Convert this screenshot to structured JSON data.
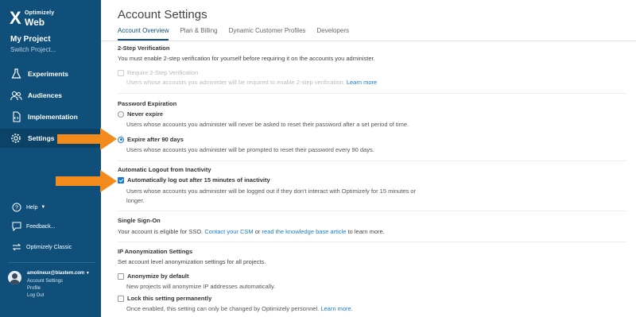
{
  "sidebar": {
    "logo_brand": "Optimizely",
    "logo_product": "Web",
    "project_name": "My Project",
    "switch_label": "Switch Project...",
    "nav": [
      {
        "label": "Experiments",
        "icon": "flask-icon"
      },
      {
        "label": "Audiences",
        "icon": "users-icon"
      },
      {
        "label": "Implementation",
        "icon": "code-icon"
      },
      {
        "label": "Settings",
        "icon": "gear-icon"
      }
    ],
    "help_label": "Help",
    "feedback_label": "Feedback...",
    "classic_label": "Optimizely Classic",
    "user": {
      "email": "amolineux@blastem.com",
      "account_settings": "Account Settings",
      "profile": "Profile",
      "logout": "Log Out"
    }
  },
  "main": {
    "title": "Account Settings",
    "tabs": [
      {
        "label": "Account Overview",
        "active": true
      },
      {
        "label": "Plan & Billing"
      },
      {
        "label": "Dynamic Customer Profiles"
      },
      {
        "label": "Developers"
      }
    ],
    "two_step": {
      "heading": "2-Step Verification",
      "text": "You must enable 2-step verification for yourself before requiring it on the accounts you administer.",
      "option": "Require 2-Step Verification",
      "option_desc": "Users whose accounts you administer will be required to enable 2-step verification.",
      "learn_more": "Learn more"
    },
    "password_expiration": {
      "heading": "Password Expiration",
      "never_label": "Never expire",
      "never_desc": "Users whose accounts you administer will never be asked to reset their password after a set period of time.",
      "expire_label": "Expire after 90 days",
      "expire_desc": "Users whose accounts you administer will be prompted to reset their password every 90 days."
    },
    "auto_logout": {
      "heading": "Automatic Logout from Inactivity",
      "option": "Automatically log out after 15 minutes of inactivity",
      "desc_line1": "Users whose accounts you administer will be logged out if they don't interact with Optimizely for 15 minutes or",
      "desc_line2": "longer."
    },
    "sso": {
      "heading": "Single Sign-On",
      "text_prefix": "Your account is eligible for SSO.",
      "contact": "Contact your CSM",
      "or": "or",
      "kb_link": "read the knowledge base article",
      "text_suffix": "to learn more."
    },
    "ip_anon": {
      "heading": "IP Anonymization Settings",
      "text": "Set account level anonymization settings for all projects.",
      "default_label": "Anonymize by default",
      "default_desc": "New projects will anonymize IP addresses automatically.",
      "lock_label": "Lock this setting permanently",
      "lock_desc": "Once enabled, this setting can only be changed by Optimizely personnel.",
      "learn_more": "Learn more."
    }
  },
  "colors": {
    "sidebar": "#0f4f7a",
    "accent": "#1a7cc9",
    "arrow": "#f28a1c"
  }
}
